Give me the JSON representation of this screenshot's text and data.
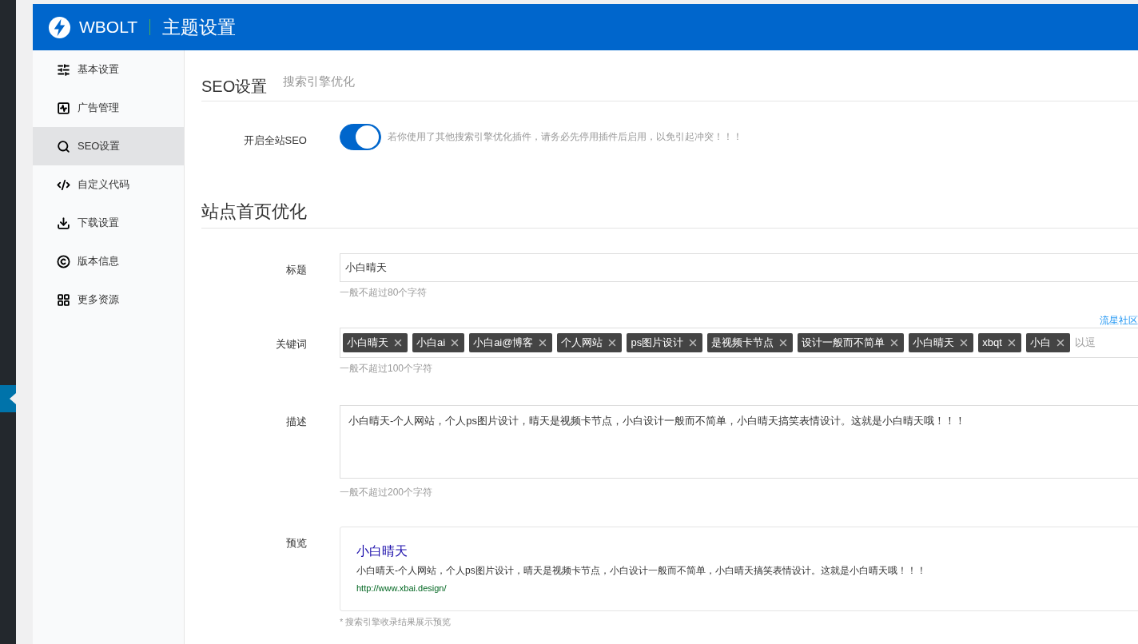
{
  "header": {
    "brand": "WBOLT",
    "title": "主题设置"
  },
  "sidebar": {
    "items": [
      {
        "label": "基本设置",
        "selected": false
      },
      {
        "label": "广告管理",
        "selected": false
      },
      {
        "label": "SEO设置",
        "selected": true
      },
      {
        "label": "自定义代码",
        "selected": false
      },
      {
        "label": "下载设置",
        "selected": false
      },
      {
        "label": "版本信息",
        "selected": false
      },
      {
        "label": "更多资源",
        "selected": false
      }
    ]
  },
  "seo_section": {
    "title": "SEO设置",
    "subtitle": "搜索引擎优化",
    "toggle": {
      "label": "开启全站SEO",
      "on": true,
      "note": "若你使用了其他搜索引擎优化插件，请务必先停用插件后启用，以免引起冲突！！！"
    }
  },
  "home_section": {
    "title": "站点首页优化",
    "title_field": {
      "label": "标题",
      "value": "小白晴天",
      "hint": "一般不超过80个字符"
    },
    "keywords": {
      "label": "关键词",
      "link": "流星社区",
      "tags": [
        "小白晴天",
        "小白ai",
        "小白ai@博客",
        "个人网站",
        "ps图片设计",
        "是视频卡节点",
        "设计一般而不简单",
        "小白晴天",
        "xbqt",
        "小白"
      ],
      "placeholder": "以逗",
      "hint": "一般不超过100个字符"
    },
    "description": {
      "label": "描述",
      "value": "小白晴天-个人网站，个人ps图片设计，晴天是视频卡节点，小白设计一般而不简单，小白晴天搞笑表情设计。这就是小白晴天哦！！！",
      "hint": "一般不超过200个字符"
    },
    "preview": {
      "label": "预览",
      "title": "小白晴天",
      "description": "小白晴天-个人网站，个人ps图片设计，晴天是视频卡节点，小白设计一般而不简单，小白晴天搞笑表情设计。这就是小白晴天哦！！！",
      "url": "http://www.xbai.design/",
      "note": "* 搜索引擎收录结果展示预览"
    }
  }
}
